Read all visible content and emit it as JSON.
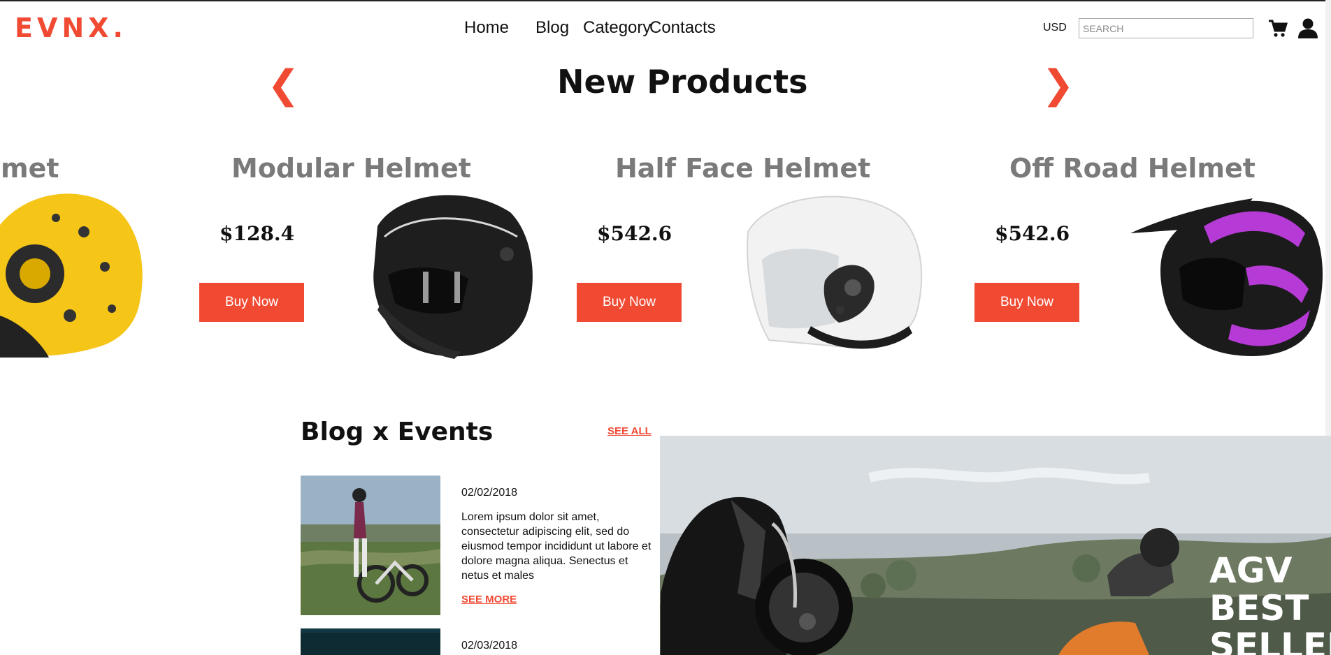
{
  "header": {
    "logo": "EVNX.",
    "nav": [
      "Home",
      "Blog",
      "Category",
      "Contacts"
    ],
    "currency": "USD",
    "search_placeholder": "SEARCH"
  },
  "new_products": {
    "title": "New Products",
    "prev": "❮",
    "next": "❯",
    "items": [
      {
        "name": "lmet",
        "color": "#f5c518"
      },
      {
        "name": "Modular Helmet",
        "price": "$128.4",
        "button": "Buy Now",
        "color": "#1e1e1e"
      },
      {
        "name": "Half Face Helmet",
        "price": "$542.6",
        "button": "Buy Now",
        "color": "#f2f2f2"
      },
      {
        "name": "Off Road Helmet",
        "price": "$542.6",
        "button": "Buy Now",
        "color": "#b53ad6"
      }
    ]
  },
  "blog": {
    "title": "Blog x Events",
    "see_all": "SEE ALL",
    "posts": [
      {
        "date": "02/02/2018",
        "excerpt": "Lorem ipsum dolor sit amet, consectetur adipiscing elit, sed do eiusmod tempor incididunt ut labore et dolore magna aliqua. Senectus et netus et males",
        "more": "SEE MORE"
      },
      {
        "date": "02/03/2018"
      }
    ]
  },
  "banner": {
    "text_lines": [
      "AGV",
      "BEST",
      "SELLER"
    ]
  },
  "colors": {
    "accent": "#f04a33"
  }
}
